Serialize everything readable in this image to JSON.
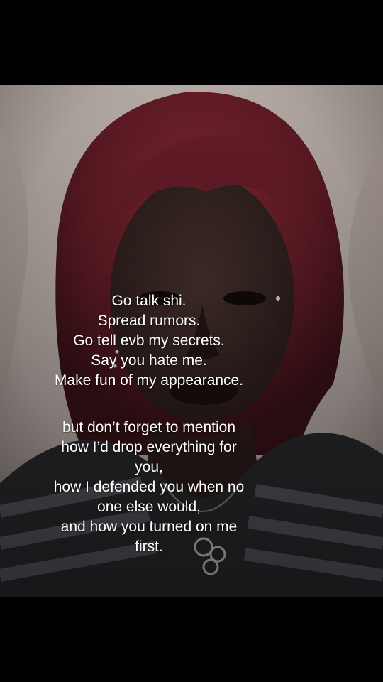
{
  "caption": {
    "stanza1": [
      "Go talk shi.",
      "Spread rumors.",
      "Go tell evb my secrets.",
      "Say you hate me.",
      "Make fun of my appearance."
    ],
    "stanza2": [
      "but don’t forget to mention",
      "how I’d drop everything for",
      "you,",
      "how I defended you when no",
      "one else would,",
      "and how you turned on me",
      "first."
    ]
  },
  "colors": {
    "letterbox": "#000000",
    "caption_text": "#ffffff",
    "hair": "#6e1f2a",
    "pillow": "#cfc6c0"
  }
}
